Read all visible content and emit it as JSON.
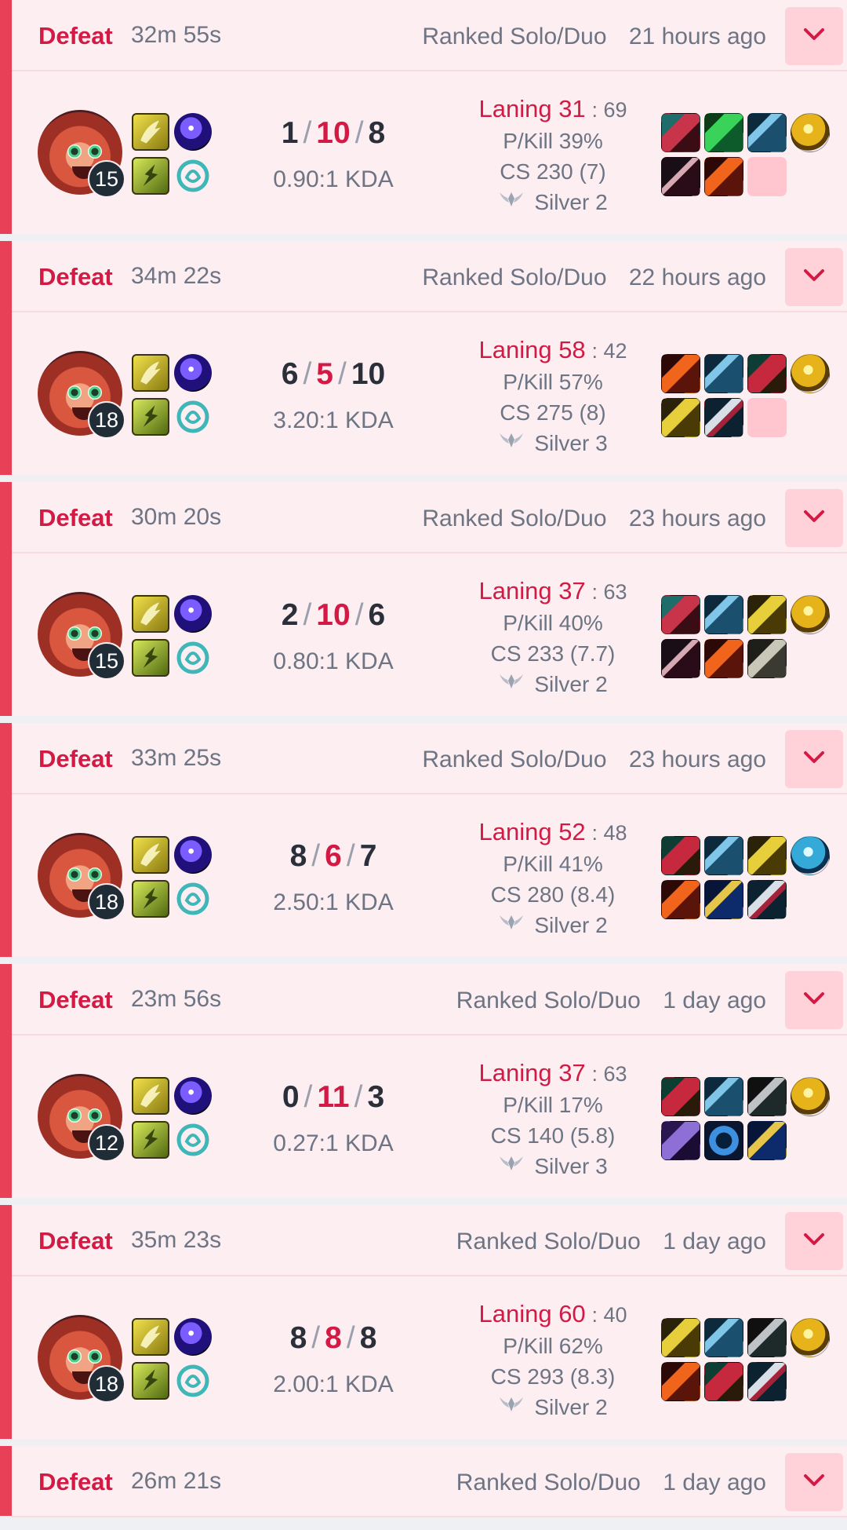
{
  "colors": {
    "accent_loss": "#e84057",
    "loss_text": "#d31a45",
    "card_bg": "#fdeef1",
    "button_bg": "#ffd1d9"
  },
  "icons": {
    "expand": "chevron-down-icon",
    "tier": "tier-emblem-icon",
    "spell1": "flash-spell-icon",
    "spell2": "ghost-spell-icon",
    "keystone": "keystone-rune-icon",
    "secondary": "secondary-rune-icon"
  },
  "matches": [
    {
      "result": "Defeat",
      "duration": "32m 55s",
      "queue": "Ranked Solo/Duo",
      "time_ago": "21 hours ago",
      "champion_level": "15",
      "kills": "1",
      "deaths": "10",
      "assists": "8",
      "kda": "0.90:1 KDA",
      "laning": "Laning 31",
      "laning_opp": ": 69",
      "pkill": "P/Kill 39%",
      "cs": "CS 230 (7)",
      "tier": "Silver 2",
      "items": [
        "item-red-blade",
        "item-green-blade",
        "item-steel-spear",
        "item-gold-orb",
        "item-dark-sword",
        "item-fire-sword",
        "empty"
      ]
    },
    {
      "result": "Defeat",
      "duration": "34m 22s",
      "queue": "Ranked Solo/Duo",
      "time_ago": "22 hours ago",
      "champion_level": "18",
      "kills": "6",
      "deaths": "5",
      "assists": "10",
      "kda": "3.20:1 KDA",
      "laning": "Laning 58",
      "laning_opp": ": 42",
      "pkill": "P/Kill 57%",
      "cs": "CS 275 (8)",
      "tier": "Silver 3",
      "items": [
        "item-fire-sword",
        "item-steel-spear",
        "item-red-boots",
        "item-gold-orb",
        "item-gold-blade",
        "item-steel-claw",
        "empty"
      ]
    },
    {
      "result": "Defeat",
      "duration": "30m 20s",
      "queue": "Ranked Solo/Duo",
      "time_ago": "23 hours ago",
      "champion_level": "15",
      "kills": "2",
      "deaths": "10",
      "assists": "6",
      "kda": "0.80:1 KDA",
      "laning": "Laning 37",
      "laning_opp": ": 63",
      "pkill": "P/Kill 40%",
      "cs": "CS 233 (7.7)",
      "tier": "Silver 2",
      "items": [
        "item-red-blade",
        "item-steel-spear",
        "item-gold-blade",
        "item-gold-orb",
        "item-dark-sword",
        "item-fire-sword",
        "item-grey-sword"
      ]
    },
    {
      "result": "Defeat",
      "duration": "33m 25s",
      "queue": "Ranked Solo/Duo",
      "time_ago": "23 hours ago",
      "champion_level": "18",
      "kills": "8",
      "deaths": "6",
      "assists": "7",
      "kda": "2.50:1 KDA",
      "laning": "Laning 52",
      "laning_opp": ": 48",
      "pkill": "P/Kill 41%",
      "cs": "CS 280 (8.4)",
      "tier": "Silver 2",
      "items": [
        "item-red-boots",
        "item-steel-spear",
        "item-gold-blade",
        "item-blue-orb",
        "item-fire-sword",
        "item-gold-staff",
        "item-steel-claw"
      ]
    },
    {
      "result": "Defeat",
      "duration": "23m 56s",
      "queue": "Ranked Solo/Duo",
      "time_ago": "1 day ago",
      "champion_level": "12",
      "kills": "0",
      "deaths": "11",
      "assists": "3",
      "kda": "0.27:1 KDA",
      "laning": "Laning 37",
      "laning_opp": ": 63",
      "pkill": "P/Kill 17%",
      "cs": "CS 140 (5.8)",
      "tier": "Silver 3",
      "items": [
        "item-red-boots",
        "item-steel-spear",
        "item-dark-axe",
        "item-gold-orb",
        "item-purple-cloak",
        "item-blue-ring",
        "item-gold-staff"
      ]
    },
    {
      "result": "Defeat",
      "duration": "35m 23s",
      "queue": "Ranked Solo/Duo",
      "time_ago": "1 day ago",
      "champion_level": "18",
      "kills": "8",
      "deaths": "8",
      "assists": "8",
      "kda": "2.00:1 KDA",
      "laning": "Laning 60",
      "laning_opp": ": 40",
      "pkill": "P/Kill 62%",
      "cs": "CS 293 (8.3)",
      "tier": "Silver 2",
      "items": [
        "item-gold-blade",
        "item-steel-spear",
        "item-dark-axe",
        "item-gold-orb",
        "item-fire-sword",
        "item-red-boots",
        "item-steel-claw"
      ]
    },
    {
      "result": "Defeat",
      "duration": "26m 21s",
      "queue": "Ranked Solo/Duo",
      "time_ago": "1 day ago",
      "header_only": true
    }
  ]
}
